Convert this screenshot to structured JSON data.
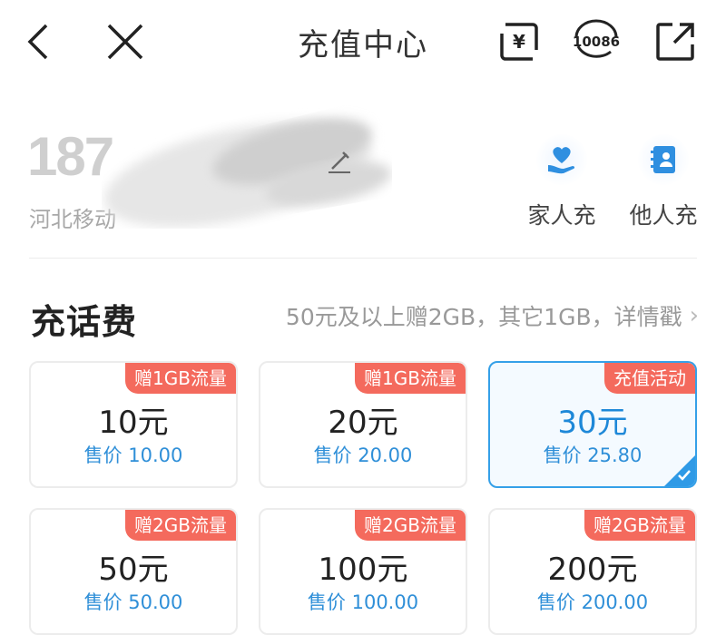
{
  "nav": {
    "title": "充值中心",
    "bill_icon_label": "¥",
    "service_icon_label": "10086"
  },
  "account": {
    "phone_prefix": "187",
    "carrier": "河北移动"
  },
  "quick_actions": [
    {
      "label": "家人充",
      "icon": "family-heart-icon"
    },
    {
      "label": "他人充",
      "icon": "contact-book-icon"
    }
  ],
  "section": {
    "title": "充话费",
    "note": "50元及以上赠2GB，其它1GB，详情戳",
    "chevron": "›"
  },
  "plans": [
    {
      "tag": "赠1GB流量",
      "amount": "10元",
      "price": "售价 10.00",
      "selected": false
    },
    {
      "tag": "赠1GB流量",
      "amount": "20元",
      "price": "售价 20.00",
      "selected": false
    },
    {
      "tag": "充值活动",
      "amount": "30元",
      "price": "售价 25.80",
      "selected": true
    },
    {
      "tag": "赠2GB流量",
      "amount": "50元",
      "price": "售价 50.00",
      "selected": false
    },
    {
      "tag": "赠2GB流量",
      "amount": "100元",
      "price": "售价 100.00",
      "selected": false
    },
    {
      "tag": "赠2GB流量",
      "amount": "200元",
      "price": "售价 200.00",
      "selected": false
    }
  ],
  "colors": {
    "accent": "#2f8fd8",
    "tag": "#f46a5d",
    "selected_border": "#35a0e8"
  }
}
